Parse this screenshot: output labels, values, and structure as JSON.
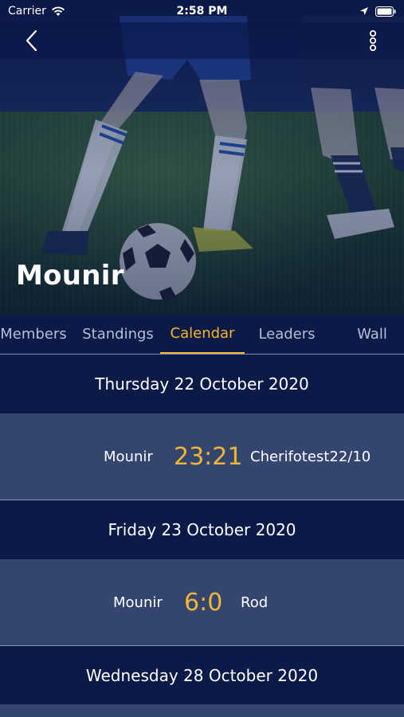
{
  "status_bar": {
    "carrier": "Carrier",
    "time": "2:58 PM"
  },
  "nav": {
    "back_icon": "chevron-left-icon",
    "more_icon": "vertical-ellipsis-icon"
  },
  "league": {
    "title": "Mounir"
  },
  "tabs": [
    {
      "label": "Members",
      "active": false
    },
    {
      "label": "Standings",
      "active": false
    },
    {
      "label": "Calendar",
      "active": true
    },
    {
      "label": "Leaders",
      "active": false
    },
    {
      "label": "Wall",
      "active": false
    }
  ],
  "calendar": {
    "days": [
      {
        "date": "Thursday 22 October 2020",
        "matches": [
          {
            "home": "Mounir",
            "score": "23:21",
            "away": "Cherifotest22/10"
          }
        ]
      },
      {
        "date": "Friday 23 October 2020",
        "matches": [
          {
            "home": "Mounir",
            "score": "6:0",
            "away": "Rod"
          }
        ]
      },
      {
        "date": "Wednesday 28 October 2020",
        "matches": []
      }
    ]
  },
  "colors": {
    "background": "#0b1a47",
    "row": "#344670",
    "accent": "#f2b632",
    "inactive_tab": "#b6bed8"
  }
}
